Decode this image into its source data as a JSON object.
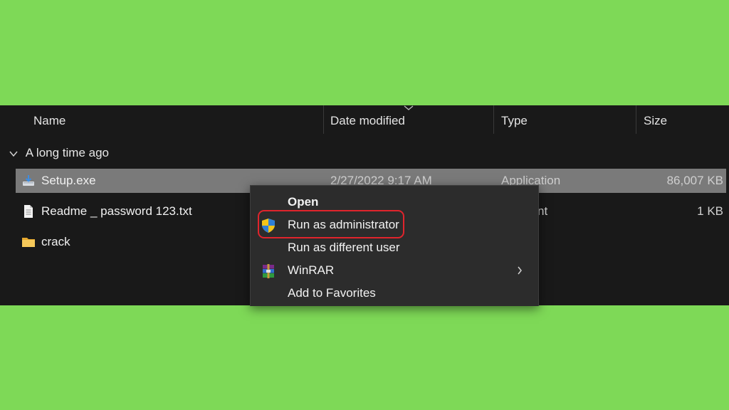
{
  "columns": {
    "name": "Name",
    "date_modified": "Date modified",
    "type": "Type",
    "size": "Size"
  },
  "group": {
    "label": "A long time ago",
    "icon": "chevron-down-icon"
  },
  "files": [
    {
      "name": "Setup.exe",
      "date": "2/27/2022 9:17 AM",
      "type": "Application",
      "size": "86,007 KB",
      "icon": "installer-icon",
      "selected": true
    },
    {
      "name": "Readme _ password 123.txt",
      "date": "",
      "type": "ocument",
      "size": "1 KB",
      "icon": "text-file-icon",
      "selected": false
    },
    {
      "name": "crack",
      "date": "",
      "type": "der",
      "size": "",
      "icon": "folder-icon",
      "selected": false
    }
  ],
  "context_menu": {
    "items": [
      {
        "label": "Open",
        "bold": true,
        "icon": ""
      },
      {
        "label": "Run as administrator",
        "bold": false,
        "icon": "uac-shield-icon",
        "highlighted": true
      },
      {
        "label": "Run as different user",
        "bold": false,
        "icon": ""
      },
      {
        "label": "WinRAR",
        "bold": false,
        "icon": "winrar-icon",
        "submenu": true
      },
      {
        "label": "Add to Favorites",
        "bold": false,
        "icon": ""
      }
    ]
  },
  "colors": {
    "background": "#7ed957",
    "explorer_bg": "#191919",
    "selected_row": "#7a7a7a",
    "menu_bg": "#2c2c2c",
    "highlight": "#e0242c",
    "folder": "#f2c14e"
  }
}
